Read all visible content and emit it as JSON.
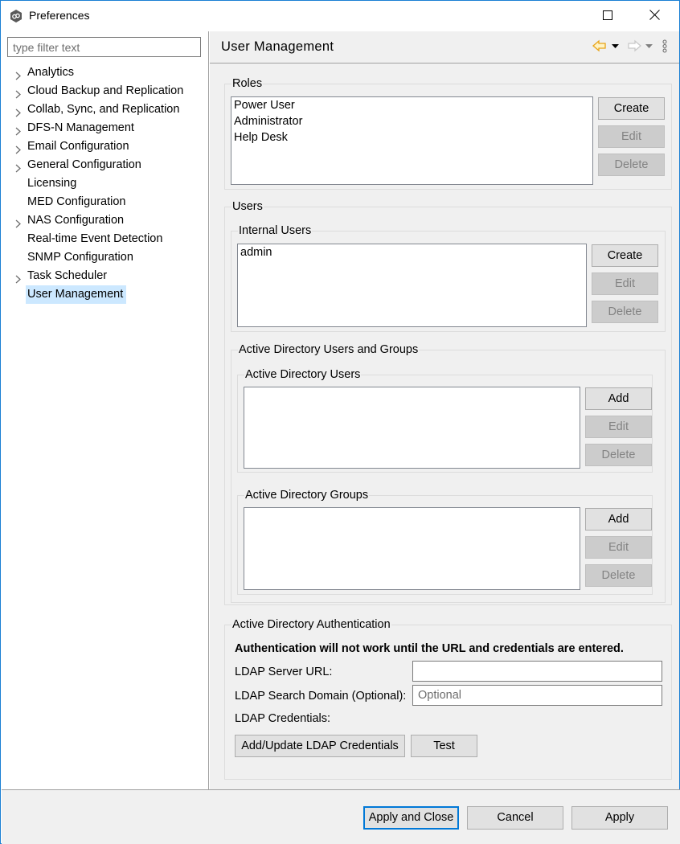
{
  "window": {
    "title": "Preferences",
    "app_icon": "peer-software-icon",
    "controls": [
      "minimize",
      "maximize",
      "close"
    ]
  },
  "sidebar": {
    "filter_placeholder": "type filter text",
    "filter_value": "",
    "items": [
      {
        "label": "Analytics",
        "expandable": true
      },
      {
        "label": "Cloud Backup and Replication",
        "expandable": true
      },
      {
        "label": "Collab, Sync, and Replication",
        "expandable": true
      },
      {
        "label": "DFS-N Management",
        "expandable": true
      },
      {
        "label": "Email Configuration",
        "expandable": true
      },
      {
        "label": "General Configuration",
        "expandable": true
      },
      {
        "label": "Licensing",
        "expandable": false
      },
      {
        "label": "MED Configuration",
        "expandable": false
      },
      {
        "label": "NAS Configuration",
        "expandable": true
      },
      {
        "label": "Real-time Event Detection",
        "expandable": false
      },
      {
        "label": "SNMP Configuration",
        "expandable": false
      },
      {
        "label": "Task Scheduler",
        "expandable": true
      },
      {
        "label": "User Management",
        "expandable": false,
        "selected": true
      }
    ]
  },
  "page": {
    "title": "User Management",
    "nav": {
      "back_icon": "back-arrow-icon",
      "forward_icon": "forward-arrow-icon",
      "menu_icon": "view-menu-icon",
      "accent_color": "#e8a317"
    },
    "roles": {
      "label": "Roles",
      "items": [
        "Power User",
        "Administrator",
        "Help Desk"
      ],
      "buttons": {
        "create": "Create",
        "edit": "Edit",
        "delete": "Delete"
      }
    },
    "users": {
      "label": "Users",
      "internal": {
        "label": "Internal Users",
        "items": [
          "admin"
        ],
        "buttons": {
          "create": "Create",
          "edit": "Edit",
          "delete": "Delete"
        }
      },
      "ad": {
        "label": "Active Directory Users and Groups",
        "users": {
          "label": "Active Directory Users",
          "items": [],
          "buttons": {
            "add": "Add",
            "edit": "Edit",
            "delete": "Delete"
          }
        },
        "groups": {
          "label": "Active Directory Groups",
          "items": [],
          "buttons": {
            "add": "Add",
            "edit": "Edit",
            "delete": "Delete"
          }
        }
      }
    },
    "auth": {
      "label": "Active Directory Authentication",
      "warning": "Authentication will not work until the URL and credentials are entered.",
      "ldap_url_label": "LDAP Server URL:",
      "ldap_url_value": "",
      "ldap_domain_label": "LDAP Search Domain (Optional):",
      "ldap_domain_placeholder": "Optional",
      "ldap_credentials_label": "LDAP Credentials:",
      "add_update_button": "Add/Update LDAP Credentials",
      "test_button": "Test"
    }
  },
  "footer": {
    "apply_close": "Apply and Close",
    "cancel": "Cancel",
    "apply": "Apply"
  }
}
